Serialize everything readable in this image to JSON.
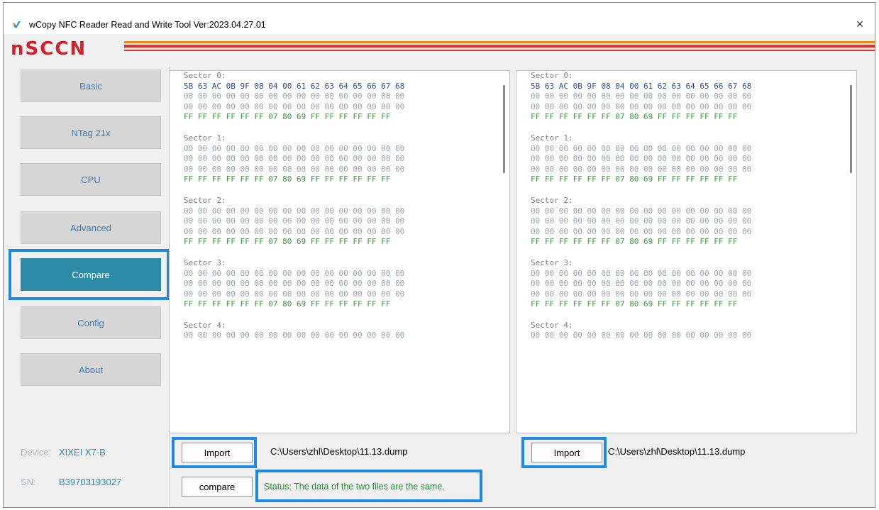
{
  "window": {
    "title": "wCopy NFC Reader Read and Write Tool  Ver:2023.04.27.01",
    "close_glyph": "×"
  },
  "banner": {
    "logo_text": "nSCCN"
  },
  "sidebar": {
    "items": [
      {
        "label": "Basic"
      },
      {
        "label": "NTag 21x"
      },
      {
        "label": "CPU"
      },
      {
        "label": "Advanced"
      },
      {
        "label": "Compare"
      },
      {
        "label": "Config"
      },
      {
        "label": "About"
      }
    ],
    "active": "Compare"
  },
  "device": {
    "device_label": "Device:",
    "device_value": "XIXEI X7-B",
    "sn_label": "SN:",
    "sn_value": "B39703193027"
  },
  "dump": {
    "sectors": [
      {
        "title": "Sector 0:",
        "lines": [
          "5B 63 AC 0B 9F 08 04 00 61 62 63 64 65 66 67 68",
          "00 00 00 00 00 00 00 00 00 00 00 00 00 00 00 00",
          "00 00 00 00 00 00 00 00 00 00 00 00 00 00 00 00",
          "FF FF FF FF FF FF 07 80 69 FF FF FF FF FF FF"
        ]
      },
      {
        "title": "Sector 1:",
        "lines": [
          "00 00 00 00 00 00 00 00 00 00 00 00 00 00 00 00",
          "00 00 00 00 00 00 00 00 00 00 00 00 00 00 00 00",
          "00 00 00 00 00 00 00 00 00 00 00 00 00 00 00 00",
          "FF FF FF FF FF FF 07 80 69 FF FF FF FF FF FF"
        ]
      },
      {
        "title": "Sector 2:",
        "lines": [
          "00 00 00 00 00 00 00 00 00 00 00 00 00 00 00 00",
          "00 00 00 00 00 00 00 00 00 00 00 00 00 00 00 00",
          "00 00 00 00 00 00 00 00 00 00 00 00 00 00 00 00",
          "FF FF FF FF FF FF 07 80 69 FF FF FF FF FF FF"
        ]
      },
      {
        "title": "Sector 3:",
        "lines": [
          "00 00 00 00 00 00 00 00 00 00 00 00 00 00 00 00",
          "00 00 00 00 00 00 00 00 00 00 00 00 00 00 00 00",
          "00 00 00 00 00 00 00 00 00 00 00 00 00 00 00 00",
          "FF FF FF FF FF FF 07 80 69 FF FF FF FF FF FF"
        ]
      },
      {
        "title": "Sector 4:",
        "lines": [
          "00 00 00 00 00 00 00 00 00 00 00 00 00 00 00 00"
        ]
      }
    ]
  },
  "left_panel": {
    "import_label": "Import",
    "path": "C:\\Users\\zhl\\Desktop\\11.13.dump"
  },
  "right_panel": {
    "import_label": "Import",
    "path": "C:\\Users\\zhl\\Desktop\\11.13.dump"
  },
  "compare": {
    "button_label": "compare",
    "status": "Status: The data of the two files are the same."
  },
  "colors": {
    "highlight": "#1e88e5",
    "active_tab": "#2d8ba8",
    "status_green": "#1a9a2a",
    "logo_red": "#d4202a"
  },
  "icons": {
    "app": "nfc-logo-icon",
    "close": "close-icon"
  }
}
